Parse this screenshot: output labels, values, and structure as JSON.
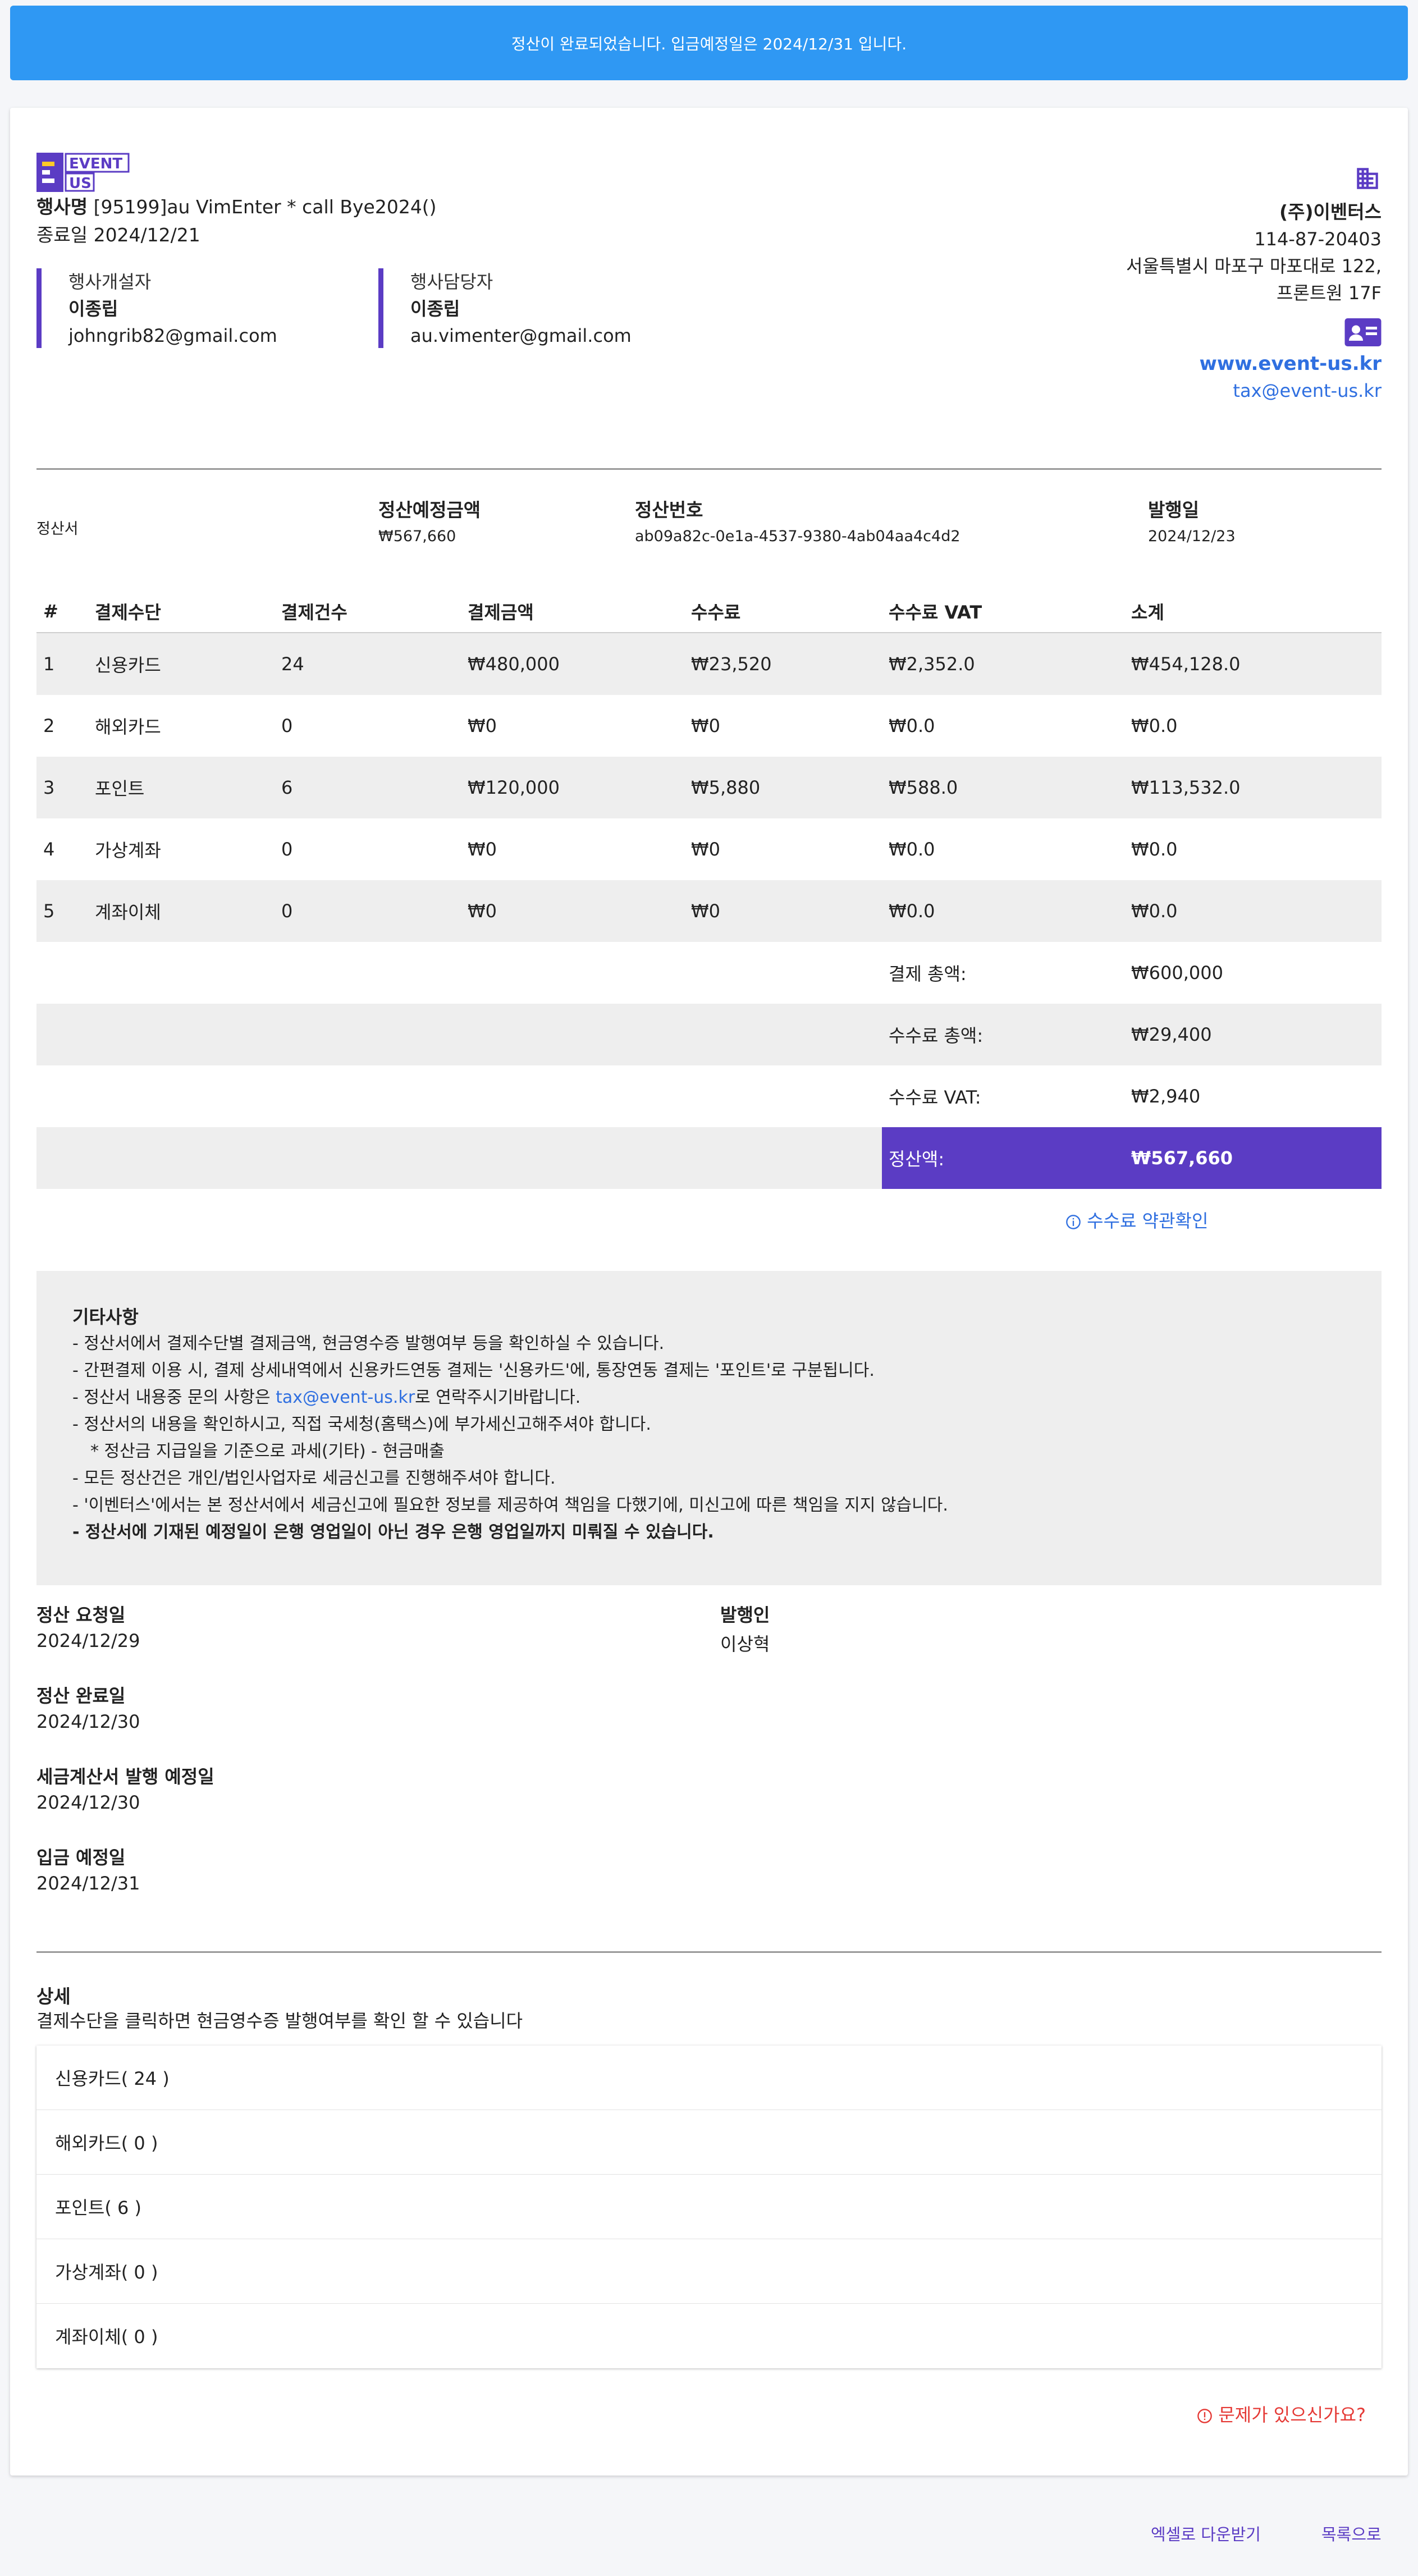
{
  "banner": {
    "message": "정산이 완료되었습니다. 입금예정일은 2024/12/31 입니다."
  },
  "logo": {
    "line1": "EVENT",
    "line2": "US"
  },
  "event": {
    "name_label": "행사명",
    "name_value": "[95199]au VimEnter * call Bye2024()",
    "end_date": "종료일 2024/12/21"
  },
  "contacts": [
    {
      "label": "행사개설자",
      "name": "이종립",
      "email": "johngrib82@gmail.com"
    },
    {
      "label": "행사담당자",
      "name": "이종립",
      "email": "au.vimenter@gmail.com"
    }
  ],
  "company": {
    "name": "(주)이벤터스",
    "reg_no": "114-87-20403",
    "address1": "서울특별시 마포구 마포대로 122,",
    "address2": "프론트원 17F",
    "website": "www.event-us.kr",
    "email": "tax@event-us.kr"
  },
  "summary": {
    "doc_label": "정산서",
    "amount_label": "정산예정금액",
    "amount_value": "₩567,660",
    "number_label": "정산번호",
    "number_value": "ab09a82c-0e1a-4537-9380-4ab04aa4c4d2",
    "issue_label": "발행일",
    "issue_value": "2024/12/23"
  },
  "table": {
    "headers": [
      "#",
      "결제수단",
      "결제건수",
      "결제금액",
      "수수료",
      "수수료 VAT",
      "소계"
    ],
    "rows": [
      [
        "1",
        "신용카드",
        "24",
        "₩480,000",
        "₩23,520",
        "₩2,352.0",
        "₩454,128.0"
      ],
      [
        "2",
        "해외카드",
        "0",
        "₩0",
        "₩0",
        "₩0.0",
        "₩0.0"
      ],
      [
        "3",
        "포인트",
        "6",
        "₩120,000",
        "₩5,880",
        "₩588.0",
        "₩113,532.0"
      ],
      [
        "4",
        "가상계좌",
        "0",
        "₩0",
        "₩0",
        "₩0.0",
        "₩0.0"
      ],
      [
        "5",
        "계좌이체",
        "0",
        "₩0",
        "₩0",
        "₩0.0",
        "₩0.0"
      ]
    ],
    "totals": [
      {
        "label": "결제 총액:",
        "value": "₩600,000"
      },
      {
        "label": "수수료 총액:",
        "value": "₩29,400"
      },
      {
        "label": "수수료 VAT:",
        "value": "₩2,940"
      },
      {
        "label": "정산액:",
        "value": "₩567,660"
      }
    ]
  },
  "fee_link": "수수료 약관확인",
  "notes": {
    "title": "기타사항",
    "line1": "- 정산서에서 결제수단별 결제금액, 현금영수증 발행여부 등을 확인하실 수 있습니다.",
    "line2": "- 간편결제 이용 시, 결제 상세내역에서 신용카드연동 결제는 '신용카드'에, 통장연동 결제는 '포인트'로 구분됩니다.",
    "line3_pre": "- 정산서 내용중 문의 사항은 ",
    "line3_link": "tax@event-us.kr",
    "line3_post": "로 연락주시기바랍니다.",
    "line4": "- 정산서의 내용을 확인하시고, 직접 국세청(홈택스)에 부가세신고해주셔야 합니다.",
    "line5": "* 정산금 지급일을 기준으로 과세(기타) - 현금매출",
    "line6": "- 모든 정산건은 개인/법인사업자로 세금신고를 진행해주셔야 합니다.",
    "line7": "- '이벤터스'에서는 본 정산서에서 세금신고에 필요한 정보를 제공하여 책임을 다했기에, 미신고에 따른 책임을 지지 않습니다.",
    "line8": "- 정산서에 기재된 예정일이 은행 영업일이 아닌 경우 은행 영업일까지 미뤄질 수 있습니다."
  },
  "info": {
    "request_label": "정산 요청일",
    "request_value": "2024/12/29",
    "issuer_label": "발행인",
    "issuer_value": "이상혁",
    "complete_label": "정산 완료일",
    "complete_value": "2024/12/30",
    "tax_label": "세금계산서 발행 예정일",
    "tax_value": "2024/12/30",
    "deposit_label": "입금 예정일",
    "deposit_value": "2024/12/31"
  },
  "detail": {
    "title": "상세",
    "subtitle": "결제수단을 클릭하면 현금영수증 발행여부를 확인 할 수 있습니다",
    "items": [
      "신용카드( 24 )",
      "해외카드( 0 )",
      "포인트( 6 )",
      "가상계좌( 0 )",
      "계좌이체( 0 )"
    ]
  },
  "problem_link": "문제가 있으신가요?",
  "footer": {
    "excel_button": "엑셀로 다운받기",
    "list_button": "목록으로"
  },
  "colors": {
    "banner": "#2f98f3",
    "accent": "#5b3cc4",
    "link": "#2f6fe0",
    "danger": "#e53935"
  },
  "icons": [
    "building-icon",
    "contact-card-icon",
    "info-circle-icon",
    "warning-circle-icon"
  ]
}
